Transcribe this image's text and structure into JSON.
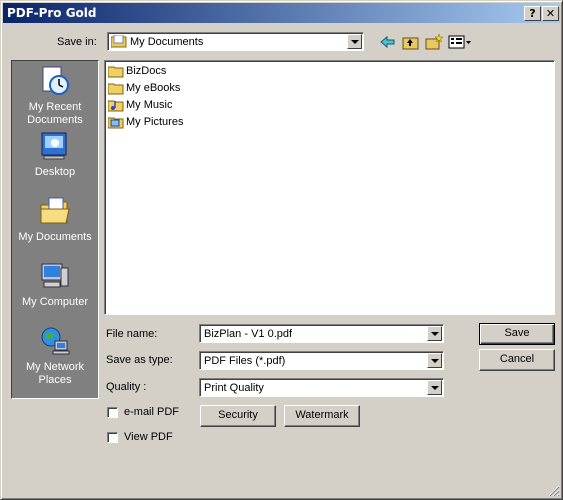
{
  "window": {
    "title": "PDF-Pro Gold",
    "help_glyph": "?",
    "close_glyph": "✕"
  },
  "save_in": {
    "label": "Save in:",
    "value": "My Documents"
  },
  "places": [
    {
      "line1": "My Recent",
      "line2": "Documents",
      "icon": "recent-documents-icon"
    },
    {
      "line1": "Desktop",
      "line2": "",
      "icon": "desktop-icon"
    },
    {
      "line1": "My Documents",
      "line2": "",
      "icon": "my-documents-icon"
    },
    {
      "line1": "My Computer",
      "line2": "",
      "icon": "my-computer-icon"
    },
    {
      "line1": "My Network",
      "line2": "Places",
      "icon": "network-places-icon"
    }
  ],
  "files": [
    {
      "name": "BizDocs",
      "icon": "folder-icon"
    },
    {
      "name": "My eBooks",
      "icon": "folder-icon"
    },
    {
      "name": "My Music",
      "icon": "music-folder-icon"
    },
    {
      "name": "My Pictures",
      "icon": "pictures-folder-icon"
    }
  ],
  "form": {
    "file_name_label": "File name:",
    "file_name_value": "BizPlan - V1 0.pdf",
    "save_as_type_label": "Save as type:",
    "save_as_type_value": "PDF Files (*.pdf)",
    "quality_label": "Quality :",
    "quality_value": "Print Quality"
  },
  "buttons": {
    "save": "Save",
    "cancel": "Cancel",
    "security": "Security",
    "watermark": "Watermark"
  },
  "checkboxes": {
    "email_pdf": "e-mail PDF",
    "view_pdf": "View PDF"
  },
  "colors": {
    "titlebar_start": "#0a246a",
    "titlebar_end": "#a6caf0",
    "face": "#d4d0c8",
    "places_bg": "#808080"
  }
}
